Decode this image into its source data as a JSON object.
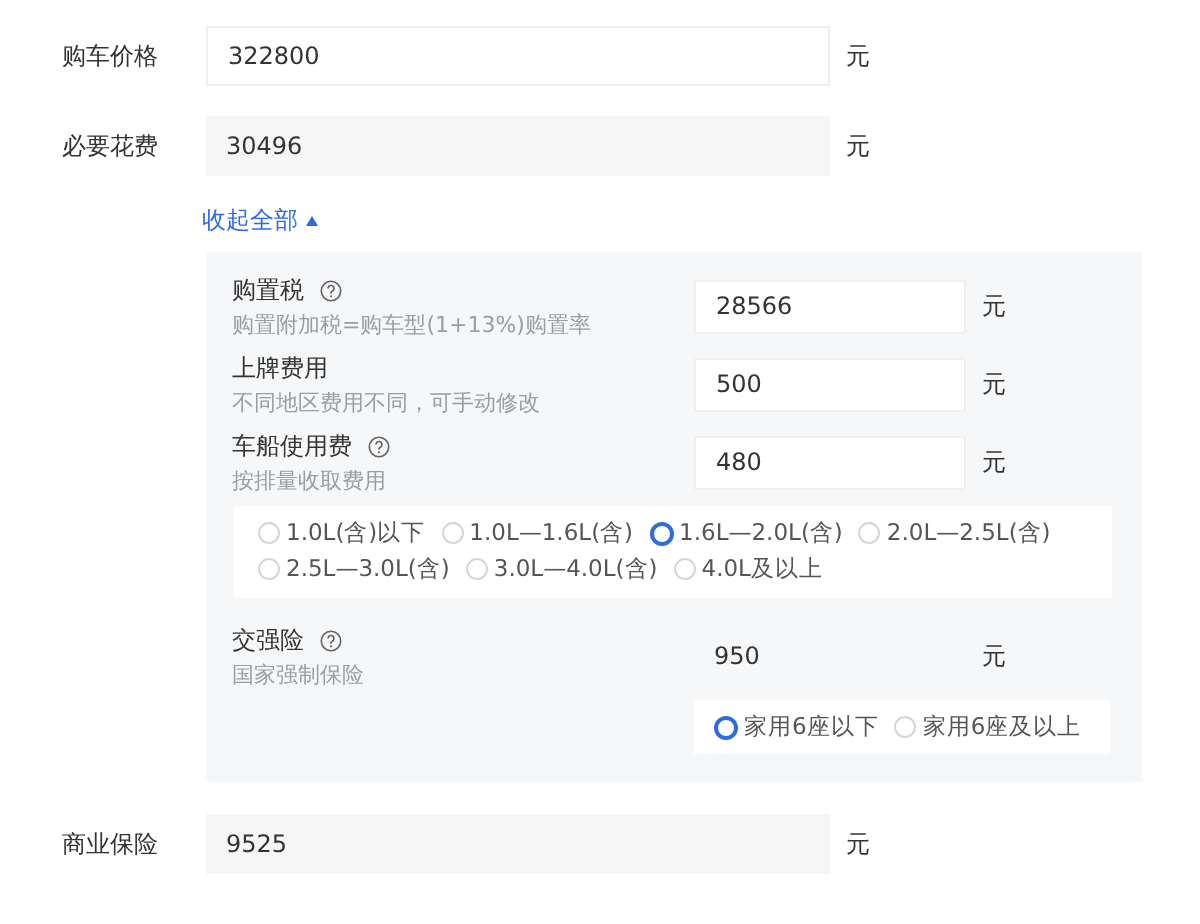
{
  "fields": [
    {
      "label": "购车价格",
      "value": "322800",
      "unit": "元",
      "editable": true
    },
    {
      "label": "必要花费",
      "value": "30496",
      "unit": "元",
      "editable": false
    }
  ],
  "toggle": {
    "label": "收起全部",
    "expanded": true
  },
  "details": [
    {
      "label": "购置税",
      "help": true,
      "hint": "购置附加税=购车型(1+13%)购置率",
      "value": "28566",
      "unit": "元",
      "editable": true
    },
    {
      "label": "上牌费用",
      "help": false,
      "hint": "不同地区费用不同，可手动修改",
      "value": "500",
      "unit": "元",
      "editable": true
    },
    {
      "label": "车船使用费",
      "help": true,
      "hint": "按排量收取费用",
      "value": "480",
      "unit": "元",
      "editable": true,
      "kind": "wide-options",
      "options": [
        {
          "label": "1.0L(含)以下",
          "selected": false
        },
        {
          "label": "1.0L—1.6L(含)",
          "selected": false
        },
        {
          "label": "1.6L—2.0L(含)",
          "selected": true
        },
        {
          "label": "2.0L—2.5L(含)",
          "selected": false
        },
        {
          "label": "2.5L—3.0L(含)",
          "selected": false
        },
        {
          "label": "3.0L—4.0L(含)",
          "selected": false
        },
        {
          "label": "4.0L及以上",
          "selected": false
        }
      ]
    },
    {
      "label": "交强险",
      "help": true,
      "hint": "国家强制保险",
      "value": "950",
      "unit": "元",
      "editable": false,
      "kind": "field-options",
      "options": [
        {
          "label": "家用6座以下",
          "selected": true
        },
        {
          "label": "家用6座及以上",
          "selected": false
        }
      ]
    }
  ],
  "bottom_fields": [
    {
      "label": "商业保险",
      "value": "9525",
      "unit": "元",
      "editable": false
    }
  ]
}
